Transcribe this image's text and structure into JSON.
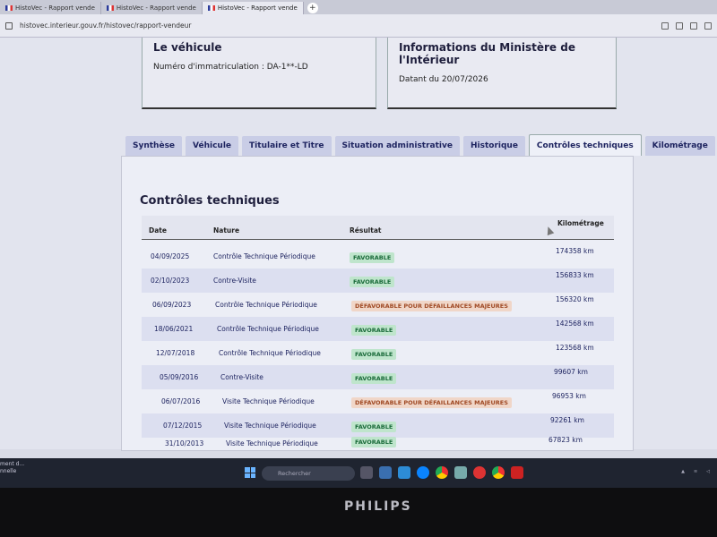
{
  "browser": {
    "tabs": [
      {
        "label": "HistoVec - Rapport vende"
      },
      {
        "label": "HistoVec - Rapport vende"
      },
      {
        "label": "HistoVec - Rapport vende"
      }
    ],
    "url": "histovec.interieur.gouv.fr/histovec/rapport-vendeur"
  },
  "vehicle_card": {
    "title": "Le véhicule",
    "registration": "Numéro d'immatriculation : DA-1**-LD"
  },
  "ministry_card": {
    "title": "Informations du Ministère de l'Intérieur",
    "date": "Datant du 20/07/2026"
  },
  "tabs": [
    {
      "label": "Synthèse"
    },
    {
      "label": "Véhicule"
    },
    {
      "label": "Titulaire et Titre"
    },
    {
      "label": "Situation administrative"
    },
    {
      "label": "Historique"
    },
    {
      "label": "Contrôles techniques"
    },
    {
      "label": "Kilométrage"
    }
  ],
  "section_title": "Contrôles techniques",
  "table": {
    "headers": [
      "Date",
      "Nature",
      "Résultat",
      "Kilométrage"
    ],
    "rows": [
      {
        "date": "04/09/2025",
        "nature": "Contrôle Technique Périodique",
        "result": "FAVORABLE",
        "km": "174358 km"
      },
      {
        "date": "02/10/2023",
        "nature": "Contre-Visite",
        "result": "FAVORABLE",
        "km": "156833 km"
      },
      {
        "date": "06/09/2023",
        "nature": "Contrôle Technique Périodique",
        "result": "DÉFAVORABLE POUR DÉFAILLANCES MAJEURES",
        "km": "156320 km"
      },
      {
        "date": "18/06/2021",
        "nature": "Contrôle Technique Périodique",
        "result": "FAVORABLE",
        "km": "142568 km"
      },
      {
        "date": "12/07/2018",
        "nature": "Contrôle Technique Périodique",
        "result": "FAVORABLE",
        "km": "123568 km"
      },
      {
        "date": "05/09/2016",
        "nature": "Contre-Visite",
        "result": "FAVORABLE",
        "km": "99607 km"
      },
      {
        "date": "06/07/2016",
        "nature": "Visite Technique Périodique",
        "result": "DÉFAVORABLE POUR DÉFAILLANCES MAJEURES",
        "km": "96953 km"
      },
      {
        "date": "07/12/2015",
        "nature": "Visite Technique Périodique",
        "result": "FAVORABLE",
        "km": "92261 km"
      },
      {
        "date": "31/10/2013",
        "nature": "Visite Technique Périodique",
        "result": "FAVORABLE",
        "km": "67823 km"
      }
    ]
  },
  "taskbar": {
    "notification": "ment d...",
    "notification_line2": "nnelle",
    "search_placeholder": "Rechercher"
  },
  "monitor_brand": "PHILIPS",
  "colors": {
    "favorable_bg": "#bfe5cc",
    "defavorable_bg": "#f0d6c8",
    "primary_text": "#1e2460"
  }
}
